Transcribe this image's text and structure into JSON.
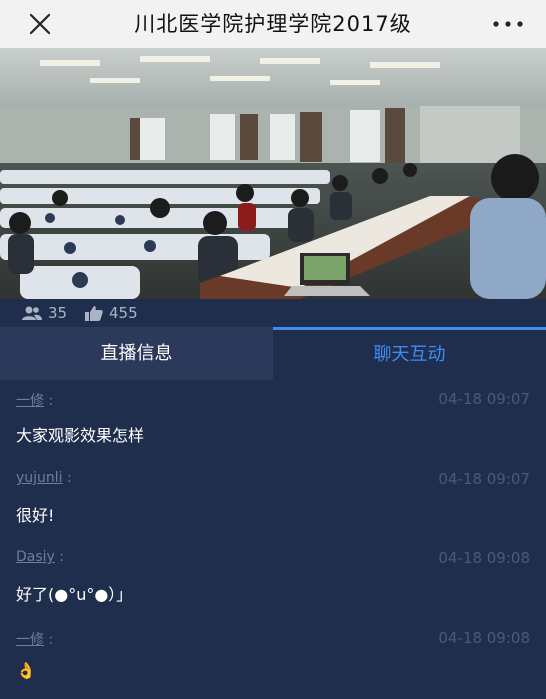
{
  "header": {
    "title": "川北医学院护理学院2017级",
    "close_icon": "close-icon",
    "more_icon": "more-icon"
  },
  "stats": {
    "viewers": "35",
    "likes": "455",
    "viewers_icon": "people-icon",
    "likes_icon": "thumbs-up-icon"
  },
  "tabs": [
    {
      "label": "直播信息",
      "active": false
    },
    {
      "label": "聊天互动",
      "active": true
    }
  ],
  "messages": [
    {
      "user": "一修",
      "time": "04-18 09:07",
      "text": "大家观影效果怎样"
    },
    {
      "user": "yujunli",
      "time": "04-18 09:07",
      "text": "很好!"
    },
    {
      "user": "Dasiy",
      "time": "04-18 09:08",
      "text": "好了(●°u°●）」"
    },
    {
      "user": "一修",
      "time": "04-18 09:08",
      "text": "👌"
    }
  ],
  "colors": {
    "background": "#1f2e4d",
    "accent": "#3e8df2",
    "header_bg": "#f2f2f2"
  }
}
